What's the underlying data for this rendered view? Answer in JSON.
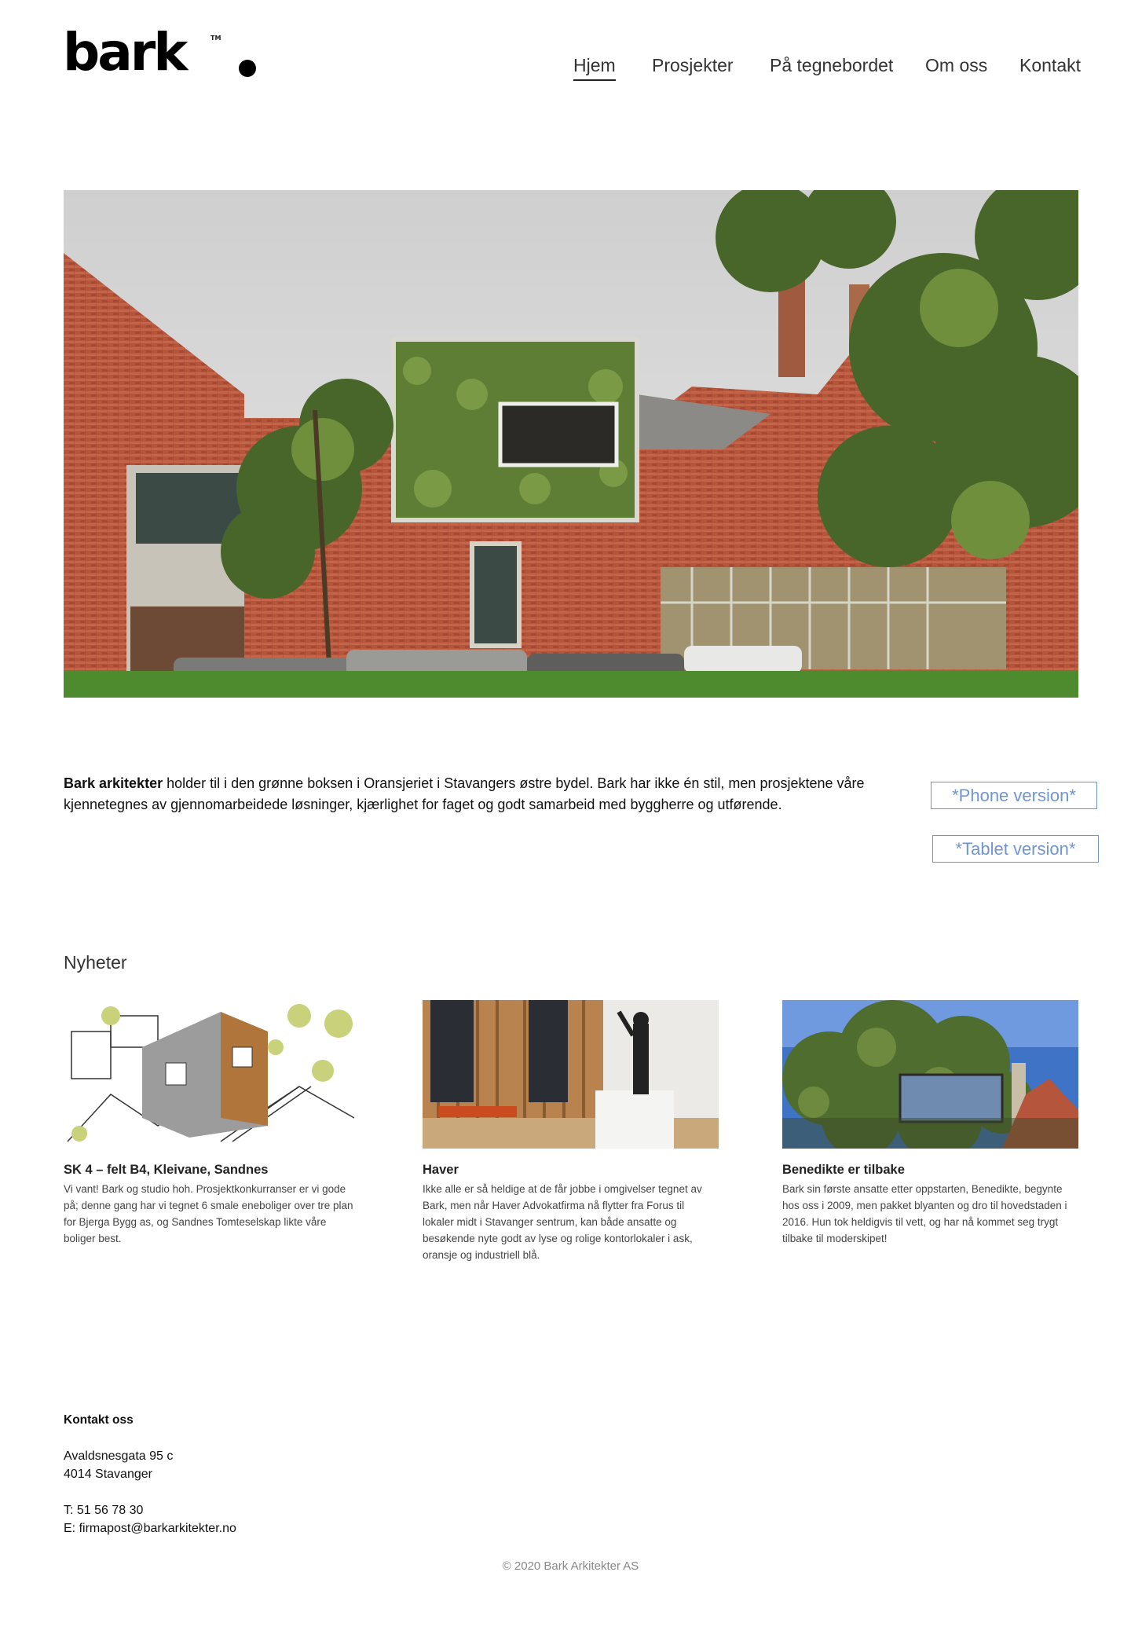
{
  "brand": {
    "logo_text": "bark",
    "logo_tm": "TM"
  },
  "nav": {
    "items": [
      {
        "label": "Hjem",
        "active": true
      },
      {
        "label": "Prosjekter",
        "active": false
      },
      {
        "label": "På tegnebordet",
        "active": false
      },
      {
        "label": "Om oss",
        "active": false
      },
      {
        "label": "Kontakt",
        "active": false
      }
    ]
  },
  "hero": {
    "alt": "Oransjeriet building with green facade box"
  },
  "intro": {
    "company": "Bark arkitekter",
    "text": " holder til i den grønne boksen i Oransjeriet i Stavangers østre bydel. Bark har ikke én stil, men prosjektene våre kjennetegnes av gjennomarbeidede løsninger, kjærlighet for faget og godt samarbeid med byggherre og utførende."
  },
  "versions": {
    "phone": "*Phone version*",
    "tablet": "*Tablet version*"
  },
  "news": {
    "title": "Nyheter",
    "items": [
      {
        "heading": "SK 4 – felt B4, Kleivane, Sandnes",
        "text": "Vi vant! Bark og studio hoh. Prosjektkonkurranser er vi gode på; denne gang har vi tegnet 6 smale eneboliger over tre plan for Bjerga Bygg as, og Sandnes Tomteselskap likte våre boliger best."
      },
      {
        "heading": "Haver",
        "text": "Ikke alle er så heldige at de får jobbe i omgivelser tegnet av Bark, men når Haver Advokatfirma nå flytter fra Forus til lokaler midt i Stavanger sentrum, kan både ansatte og besøkende nyte godt av lyse og rolige kontorlokaler i ask, oransje og industriell blå."
      },
      {
        "heading": "Benedikte er tilbake",
        "text": "Bark sin første ansatte etter oppstarten, Benedikte, begynte hos oss i 2009, men pakket blyanten og dro til hovedstaden i 2016. Hun tok heldigvis til vett, og har nå kommet seg trygt tilbake til moderskipet!"
      }
    ]
  },
  "contact": {
    "title": "Kontakt oss",
    "address_line1": "Avaldsnesgata 95 c",
    "address_line2": "4014 Stavanger",
    "phone": "T:  51 56 78 30",
    "email": "E: firmapost@barkarkitekter.no"
  },
  "footer": {
    "copyright": "© 2020 Bark Arkitekter AS"
  },
  "colors": {
    "accent_blue": "#6f96d3",
    "brick": "#b5553c",
    "green": "#5e7d35"
  }
}
